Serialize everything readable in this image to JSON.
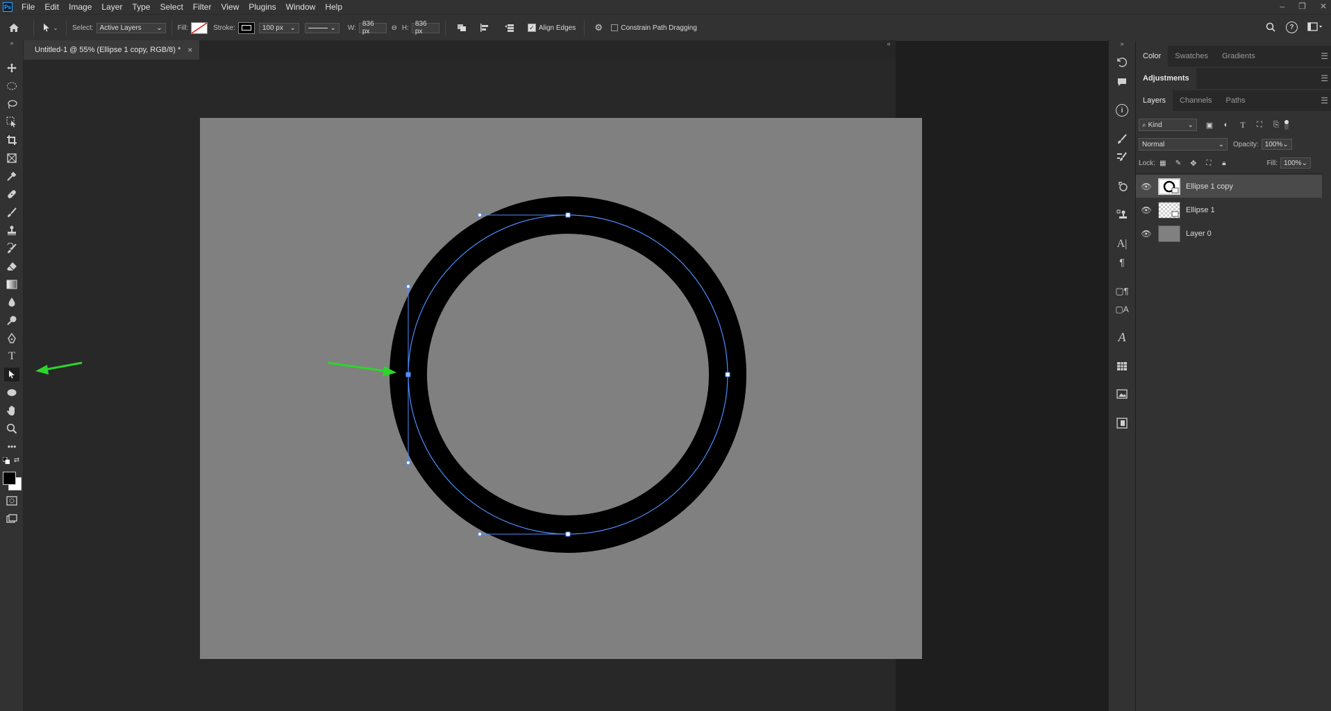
{
  "app": {
    "logo": "Ps"
  },
  "menu": [
    "File",
    "Edit",
    "Image",
    "Layer",
    "Type",
    "Select",
    "Filter",
    "View",
    "Plugins",
    "Window",
    "Help"
  ],
  "window_controls": {
    "minimize": "–",
    "restore": "❐",
    "close": "✕"
  },
  "options_bar": {
    "select_label": "Select:",
    "select_value": "Active Layers",
    "fill_label": "Fill:",
    "stroke_label": "Stroke:",
    "stroke_width": "100 px",
    "w_label": "W:",
    "w_value": "836 px",
    "h_label": "H:",
    "h_value": "836 px",
    "align_edges_label": "Align Edges",
    "align_edges_checked": true,
    "constrain_label": "Constrain Path Dragging",
    "constrain_checked": false
  },
  "document_tab": {
    "title": "Untitled-1 @ 55% (Ellipse 1 copy, RGB/8) *",
    "close": "×"
  },
  "panels": {
    "color_tabs": [
      "Color",
      "Swatches",
      "Gradients"
    ],
    "adjustments_tab": "Adjustments",
    "layer_tabs": [
      "Layers",
      "Channels",
      "Paths"
    ],
    "kind_filter": "Kind",
    "blend_mode": "Normal",
    "opacity_label": "Opacity:",
    "opacity_value": "100%",
    "lock_label": "Lock:",
    "fill_label": "Fill:",
    "fill_value": "100%",
    "layers": [
      {
        "name": "Ellipse 1 copy",
        "selected": true
      },
      {
        "name": "Ellipse 1",
        "selected": false
      },
      {
        "name": "Layer 0",
        "selected": false
      }
    ]
  },
  "colors": {
    "accent_arrow": "#2bd62b",
    "path": "#4f8fff",
    "canvas": "#808080"
  }
}
